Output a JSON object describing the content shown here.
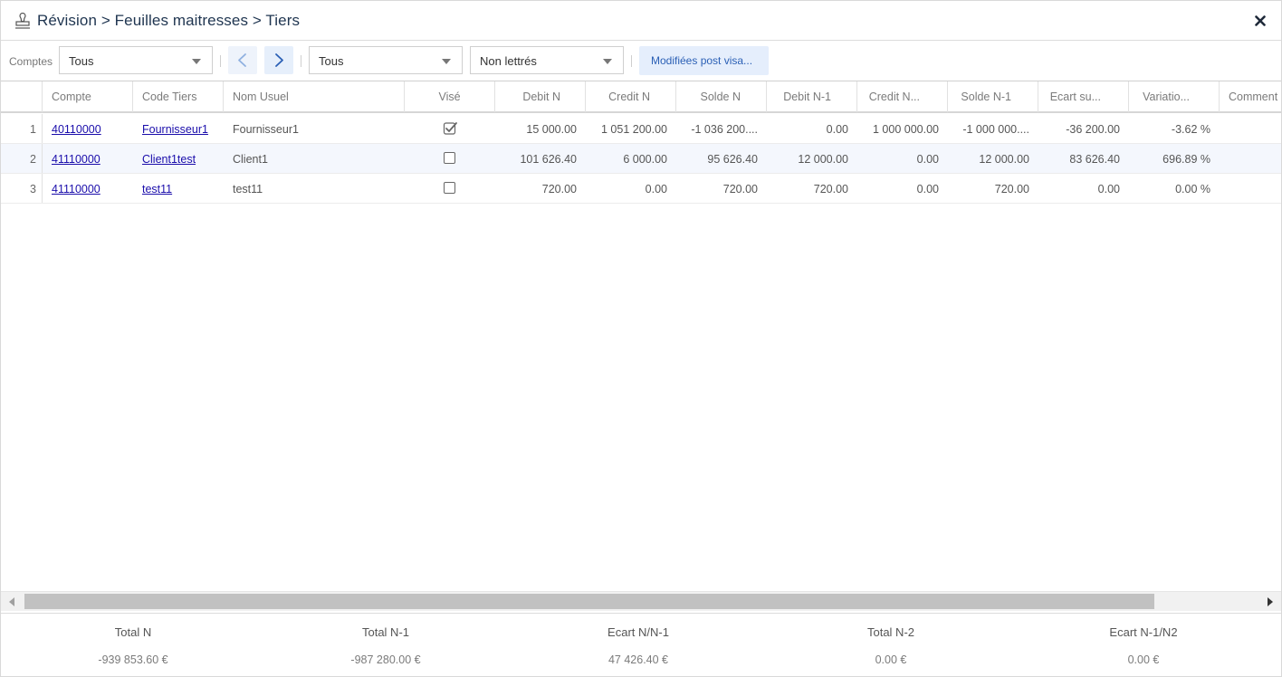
{
  "window": {
    "title": "Révision > Feuilles maitresses > Tiers"
  },
  "toolbar": {
    "comptes_label": "Comptes",
    "comptes_select": "Tous",
    "filter_select": "Tous",
    "lettrage_select": "Non lettrés",
    "post_visa_button": "Modifiées post visa..."
  },
  "grid": {
    "columns": [
      "Compte",
      "Code Tiers",
      "Nom Usuel",
      "Visé",
      "Debit N",
      "Credit N",
      "Solde N",
      "Debit N-1",
      "Credit N...",
      "Solde N-1",
      "Ecart su...",
      "Variatio...",
      "Comment"
    ],
    "rows": [
      {
        "num": "1",
        "compte": "40110000",
        "code": "Fournisseur1",
        "nom": "Fournisseur1",
        "vise": true,
        "debit_n": "15 000.00",
        "credit_n": "1 051 200.00",
        "solde_n": "-1 036 200....",
        "debit_n1": "0.00",
        "credit_n1": "1 000 000.00",
        "solde_n1": "-1 000 000....",
        "ecart": "-36 200.00",
        "variation": "-3.62 %"
      },
      {
        "num": "2",
        "compte": "41110000",
        "code": "Client1test",
        "nom": "Client1",
        "vise": false,
        "debit_n": "101 626.40",
        "credit_n": "6 000.00",
        "solde_n": "95 626.40",
        "debit_n1": "12 000.00",
        "credit_n1": "0.00",
        "solde_n1": "12 000.00",
        "ecart": "83 626.40",
        "variation": "696.89 %"
      },
      {
        "num": "3",
        "compte": "41110000",
        "code": "test11",
        "nom": "test11",
        "vise": false,
        "debit_n": "720.00",
        "credit_n": "0.00",
        "solde_n": "720.00",
        "debit_n1": "720.00",
        "credit_n1": "0.00",
        "solde_n1": "720.00",
        "ecart": "0.00",
        "variation": "0.00 %"
      }
    ]
  },
  "totals": [
    {
      "label": "Total N",
      "value": "-939 853.60 €"
    },
    {
      "label": "Total N-1",
      "value": "-987 280.00 €"
    },
    {
      "label": "Ecart N/N-1",
      "value": "47 426.40 €"
    },
    {
      "label": "Total N-2",
      "value": "0.00 €"
    },
    {
      "label": "Ecart N-1/N2",
      "value": "0.00 €"
    }
  ],
  "icons": {
    "title": "stamp-icon",
    "close": "close-icon",
    "prev": "chevron-left-icon",
    "next": "chevron-right-icon"
  },
  "colors": {
    "title": "#1f3550",
    "link": "#1a0dab",
    "accent_bg": "#e5eefc",
    "accent_text": "#2a5fb5"
  }
}
